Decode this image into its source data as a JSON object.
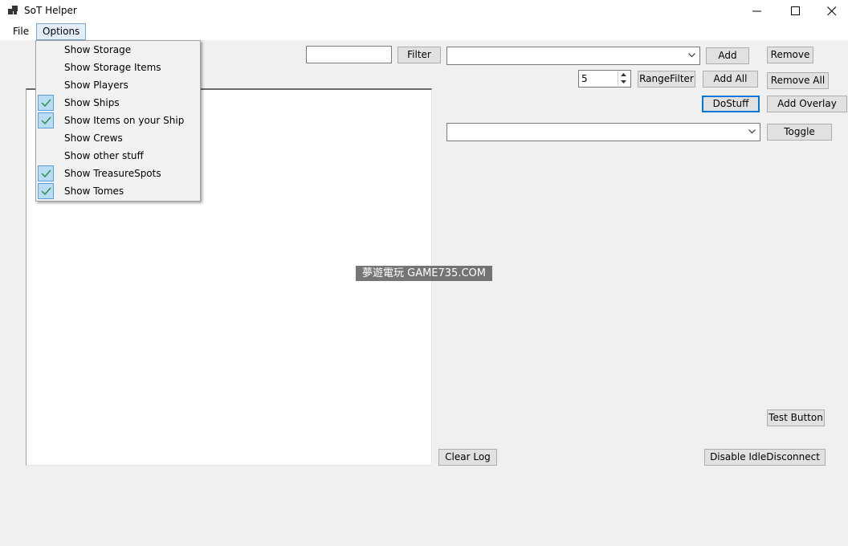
{
  "window": {
    "title": "SoT Helper",
    "controls": [
      "minimize-icon",
      "maximize-icon",
      "close-icon"
    ]
  },
  "menubar": {
    "items": [
      {
        "label": "File"
      },
      {
        "label": "Options",
        "open": true
      }
    ]
  },
  "options_menu": {
    "items": [
      {
        "label": "Show Storage",
        "checked": false
      },
      {
        "label": "Show Storage Items",
        "checked": false
      },
      {
        "label": "Show Players",
        "checked": false
      },
      {
        "label": "Show Ships",
        "checked": true
      },
      {
        "label": "Show Items on your Ship",
        "checked": true
      },
      {
        "label": "Show Crews",
        "checked": false
      },
      {
        "label": "Show other stuff",
        "checked": false
      },
      {
        "label": "Show TreasureSpots",
        "checked": true
      },
      {
        "label": "Show Tomes",
        "checked": true
      }
    ]
  },
  "toolbar": {
    "filter_input_value": "",
    "filter_label": "Filter",
    "item_combo_value": "",
    "add_label": "Add",
    "remove_label": "Remove",
    "range_value": "5",
    "range_filter_label": "RangeFilter",
    "add_all_label": "Add All",
    "remove_all_label": "Remove All",
    "dostuff_label": "DoStuff",
    "add_overlay_label": "Add Overlay",
    "toggle_combo_value": "",
    "toggle_label": "Toggle",
    "test_button_label": "Test Button",
    "clear_log_label": "Clear Log",
    "disable_idle_label": "Disable IdleDisconnect"
  },
  "watermark": "夢遊電玩 GAME735.COM",
  "colors": {
    "accent": "#0078d7",
    "check_bg": "#b9dcf5",
    "check_mark": "#2e8b3d"
  }
}
